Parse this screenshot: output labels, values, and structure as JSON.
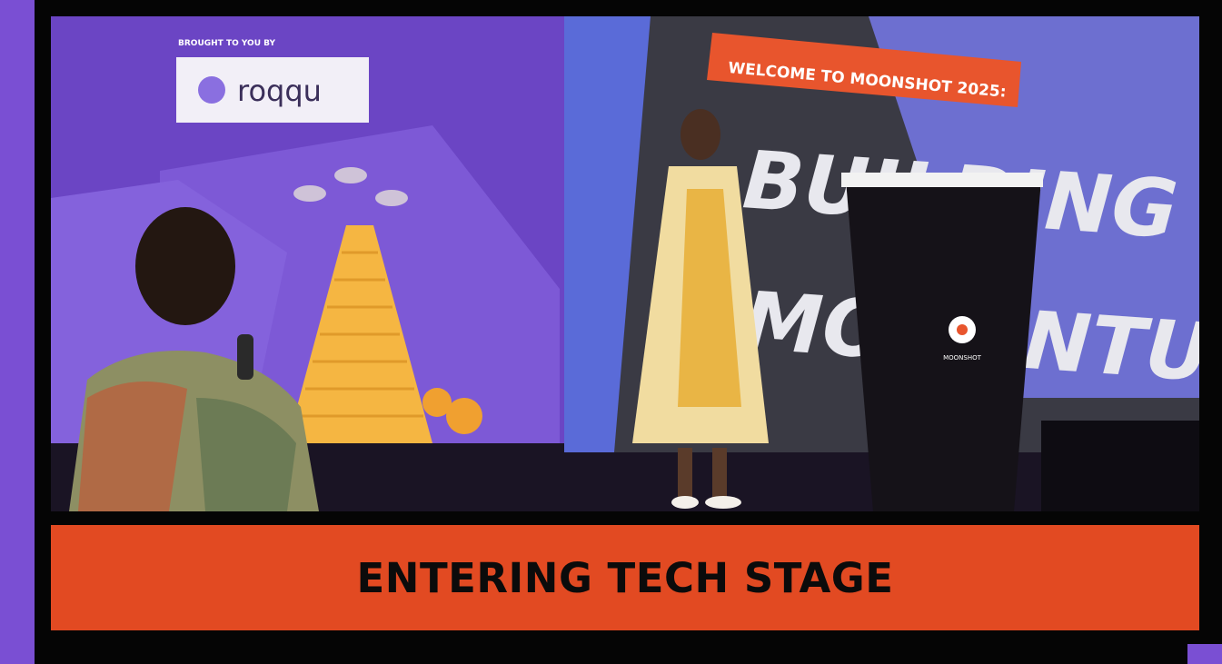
{
  "banner": {
    "title": "ENTERING TECH STAGE"
  },
  "stage": {
    "sponsor_caption": "BROUGHT TO YOU BY",
    "sponsor_name": "roqqu",
    "welcome_sign": "WELCOME TO MOONSHOT 2025:",
    "headline_line1": "BUILDING",
    "headline_line2": "MOMENTUM",
    "podium_logo": "MOONSHOT"
  },
  "colors": {
    "frame": "#050505",
    "accent_purple": "#7a4fd3",
    "banner_orange": "#e24a22",
    "sign_orange": "#e8552d"
  }
}
